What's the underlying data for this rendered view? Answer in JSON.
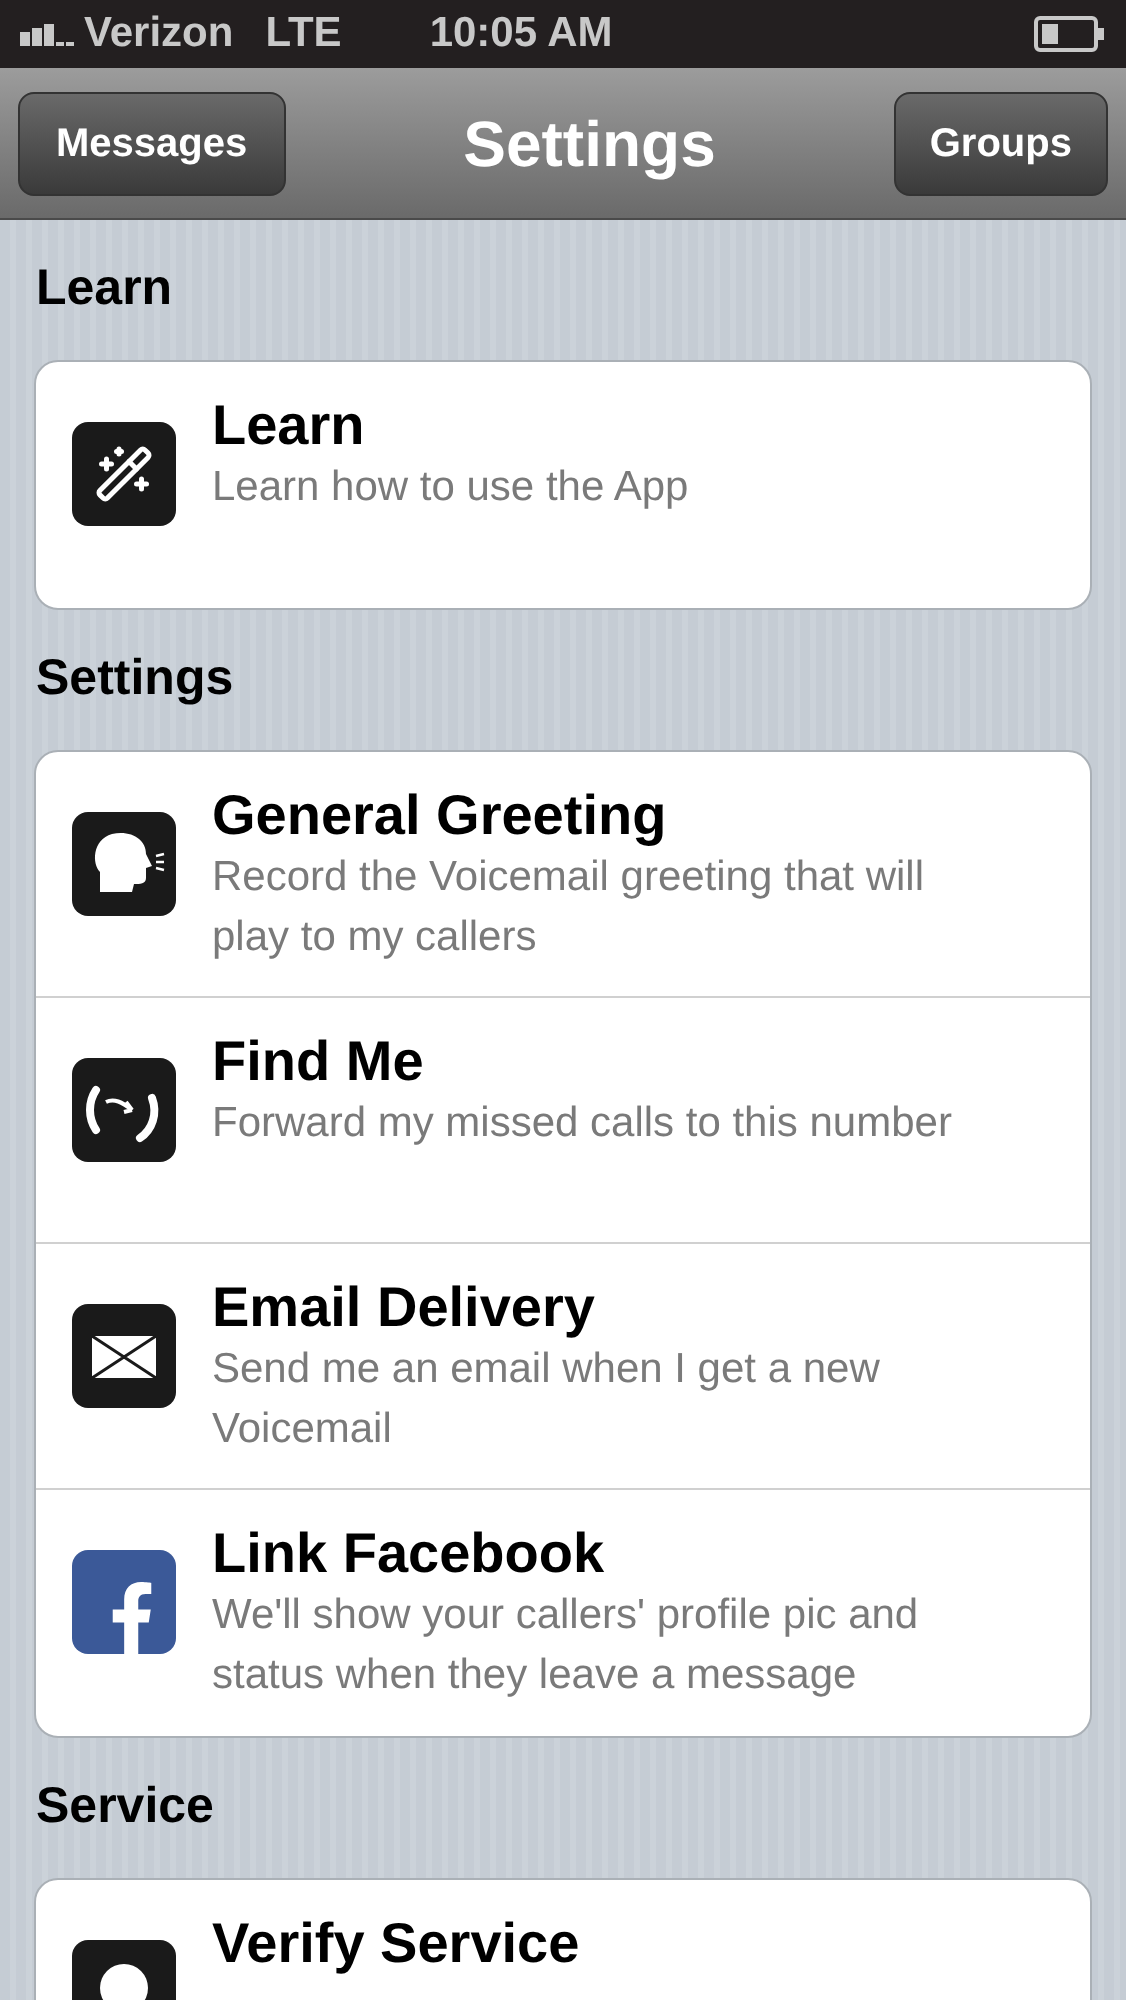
{
  "status_bar": {
    "carrier": "Verizon",
    "network": "LTE",
    "time": "10:05 AM"
  },
  "nav_bar": {
    "title": "Settings",
    "left_button": "Messages",
    "right_button": "Groups"
  },
  "sections": [
    {
      "header": "Learn",
      "items": [
        {
          "title": "Learn",
          "subtitle": "Learn how to use the App"
        }
      ]
    },
    {
      "header": "Settings",
      "items": [
        {
          "title": "General Greeting",
          "subtitle": "Record the Voicemail greeting that will play to my callers"
        },
        {
          "title": "Find Me",
          "subtitle": "Forward my missed calls to this number"
        },
        {
          "title": "Email Delivery",
          "subtitle": "Send me an email when I get a new Voicemail"
        },
        {
          "title": "Link Facebook",
          "subtitle": "We'll show your callers' profile pic and status when they leave a message"
        }
      ]
    },
    {
      "header": "Service",
      "items": [
        {
          "title": "Verify Service"
        }
      ]
    }
  ]
}
